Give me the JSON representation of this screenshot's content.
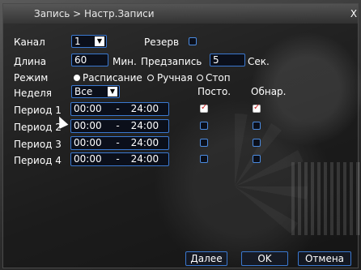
{
  "window": {
    "title": "Запись > Настр.Записи",
    "close": "X"
  },
  "form": {
    "channel_label": "Канал",
    "channel_value": "1",
    "reserve_label": "Резерв",
    "length_label": "Длина",
    "length_value": "60",
    "min_label": "Мин.",
    "prerecord_label": "Предзапись",
    "prerecord_value": "5",
    "sec_label": "Сек.",
    "mode_label": "Режим",
    "mode_options": [
      "Расписание",
      "Ручная",
      "Стоп"
    ],
    "mode_selected": "Расписание",
    "week_label": "Неделя",
    "week_value": "Все",
    "col_constant": "Посто.",
    "col_detect": "Обнар."
  },
  "periods": [
    {
      "label": "Период 1",
      "start": "00:00",
      "dash": "-",
      "end": "24:00",
      "constant": true,
      "detect": true
    },
    {
      "label": "Период 2",
      "start": "00:00",
      "dash": "-",
      "end": "24:00",
      "constant": false,
      "detect": false
    },
    {
      "label": "Период 3",
      "start": "00:00",
      "dash": "-",
      "end": "24:00",
      "constant": false,
      "detect": false
    },
    {
      "label": "Период 4",
      "start": "00:00",
      "dash": "-",
      "end": "24:00",
      "constant": false,
      "detect": false
    }
  ],
  "buttons": {
    "next": "Далее",
    "ok": "OK",
    "cancel": "Отмена"
  },
  "colors": {
    "accent": "#3a78d0"
  }
}
